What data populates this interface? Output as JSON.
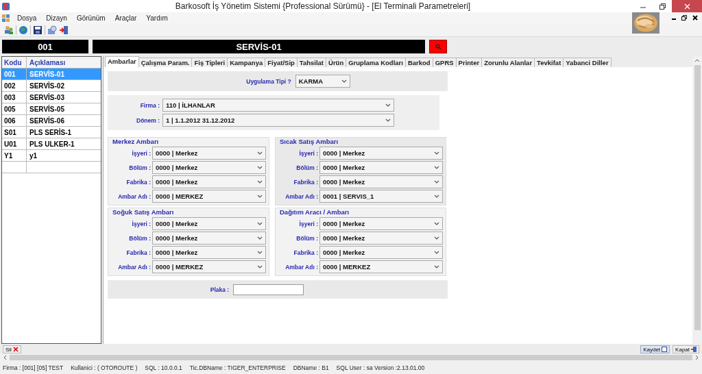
{
  "window": {
    "title": "Barkosoft İş Yönetim Sistemi {Professional Sürümü} - [El Terminali Parametreleri]"
  },
  "menu": [
    "Dosya",
    "Dizayn",
    "Görünüm",
    "Araçlar",
    "Yardım"
  ],
  "header": {
    "code": "001",
    "name": "SERVİS-01"
  },
  "list": {
    "columns": [
      "Kodu",
      "Açıklaması"
    ],
    "rows": [
      {
        "code": "001",
        "name": "SERVİS-01",
        "selected": true
      },
      {
        "code": "002",
        "name": "SERVİS-02",
        "selected": false
      },
      {
        "code": "003",
        "name": "SERVİS-03",
        "selected": false
      },
      {
        "code": "005",
        "name": "SERVİS-05",
        "selected": false
      },
      {
        "code": "006",
        "name": "SERVİS-06",
        "selected": false
      },
      {
        "code": "S01",
        "name": "PLS SERİS-1",
        "selected": false
      },
      {
        "code": "U01",
        "name": "PLS ULKER-1",
        "selected": false
      },
      {
        "code": "Y1",
        "name": "y1",
        "selected": false
      }
    ]
  },
  "tabs": [
    {
      "label": "Ambarlar",
      "selected": true
    },
    {
      "label": "Çalışma Param.",
      "selected": false
    },
    {
      "label": "Fiş Tipleri",
      "selected": false
    },
    {
      "label": "Kampanya",
      "selected": false
    },
    {
      "label": "Fiyat/Sip",
      "selected": false
    },
    {
      "label": "Tahsilat",
      "selected": false
    },
    {
      "label": "Ürün",
      "selected": false
    },
    {
      "label": "Gruplama Kodları",
      "selected": false
    },
    {
      "label": "Barkod",
      "selected": false
    },
    {
      "label": "GPRS",
      "selected": false
    },
    {
      "label": "Printer",
      "selected": false
    },
    {
      "label": "Zorunlu Alanlar",
      "selected": false
    },
    {
      "label": "Tevkifat",
      "selected": false
    },
    {
      "label": "Yabanci Diller",
      "selected": false
    }
  ],
  "app_type": {
    "label": "Uygulama Tipi ?",
    "value": "KARMA"
  },
  "company": [
    {
      "label": "Firma :",
      "value": "110 | İLHANLAR"
    },
    {
      "label": "Dönem :",
      "value": "1 | 1.1.2012 31.12.2012"
    }
  ],
  "groups": [
    {
      "title": "Merkez Ambarı",
      "fields": [
        {
          "label": "İşyeri :",
          "value": "0000 | Merkez"
        },
        {
          "label": "Bölüm :",
          "value": "0000 | Merkez"
        },
        {
          "label": "Fabrika :",
          "value": "0000 | Merkez"
        },
        {
          "label": "Ambar Adı :",
          "value": "0000 | MERKEZ"
        }
      ]
    },
    {
      "title": "Sıcak Satış Ambarı",
      "fields": [
        {
          "label": "İşyeri :",
          "value": "0000 | Merkez"
        },
        {
          "label": "Bölüm :",
          "value": "0000 | Merkez"
        },
        {
          "label": "Fabrika :",
          "value": "0000 | Merkez"
        },
        {
          "label": "Ambar Adı :",
          "value": "0001 | SERVIS_1"
        }
      ]
    },
    {
      "title": "Soğuk Satış Ambarı",
      "fields": [
        {
          "label": "İşyeri :",
          "value": "0000 | Merkez"
        },
        {
          "label": "Bölüm :",
          "value": "0000 | Merkez"
        },
        {
          "label": "Fabrika :",
          "value": "0000 | Merkez"
        },
        {
          "label": "Ambar Adı :",
          "value": "0000 | MERKEZ"
        }
      ]
    },
    {
      "title": "Dağıtım Aracı / Ambarı",
      "fields": [
        {
          "label": "İşyeri :",
          "value": "0000 | Merkez"
        },
        {
          "label": "Bölüm :",
          "value": "0000 | Merkez"
        },
        {
          "label": "Fabrika :",
          "value": "0000 | Merkez"
        },
        {
          "label": "Ambar Adı :",
          "value": "0000 | MERKEZ"
        }
      ]
    }
  ],
  "plate": {
    "label": "Plaka :"
  },
  "buttons": [
    "Sil",
    "Kaydet",
    "Kapat"
  ],
  "status_bar": [
    "Firma : [001] [05]  TEST",
    "Kullanici : ( OTOROUTE )",
    "SQL : 10.0.0.1",
    "Tic.DBName : TIGER_ENTERPRISE",
    "DBName : B1",
    "SQL User : sa  Version :2.13.01.00"
  ]
}
